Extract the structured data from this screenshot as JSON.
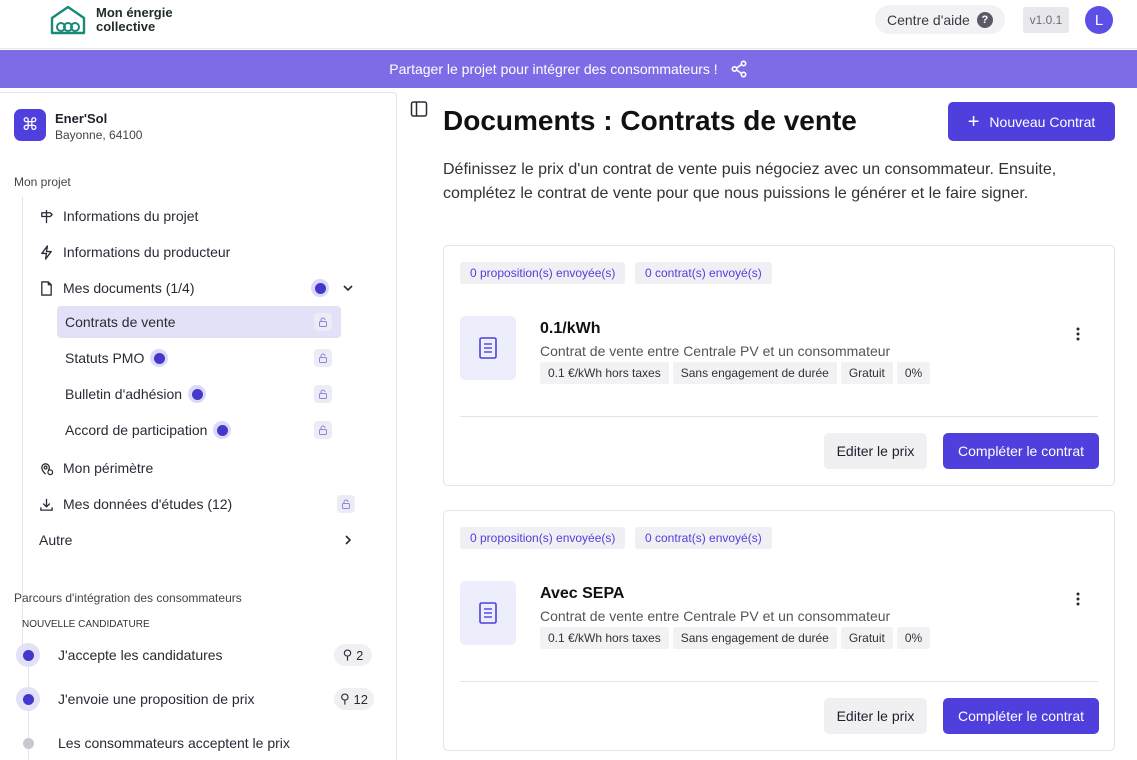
{
  "header": {
    "logo_line1": "Mon énergie",
    "logo_line2": "collective",
    "help_label": "Centre d'aide",
    "help_icon": "?",
    "version": "v1.0.1",
    "avatar_initial": "L"
  },
  "banner": {
    "text": "Partager le projet pour intégrer des consommateurs !",
    "icon": "share-icon"
  },
  "sidebar": {
    "project": {
      "icon": "⌘",
      "name": "Ener'Sol",
      "location": "Bayonne, 64100"
    },
    "section_project": "Mon projet",
    "items": {
      "info_projet": "Informations du projet",
      "info_producteur": "Informations du producteur",
      "mes_documents": "Mes documents (1/4)",
      "contrats": "Contrats de vente",
      "statuts": "Statuts PMO",
      "bulletin": "Bulletin d'adhésion",
      "accord": "Accord de participation",
      "perimetre": "Mon périmètre",
      "donnees": "Mes données d'études (12)",
      "autre": "Autre"
    },
    "section_parcours": "Parcours d'intégration des consommateurs",
    "stage_label": "NOUVELLE CANDIDATURE",
    "steps": [
      {
        "label": "J'accepte les candidatures",
        "count": "2"
      },
      {
        "label": "J'envoie une proposition de prix",
        "count": "12"
      },
      {
        "label": "Les consommateurs acceptent le prix",
        "count": ""
      }
    ]
  },
  "main": {
    "title": "Documents : Contrats de vente",
    "new_button": "Nouveau Contrat",
    "description": "Définissez le prix d'un contrat de vente puis négociez avec un consommateur. Ensuite, complétez le contrat de vente pour que nous puissions le générer et le faire signer.",
    "contracts": [
      {
        "chip_proposals": "0 proposition(s) envoyée(s)",
        "chip_contracts": "0 contrat(s) envoyé(s)",
        "title": "0.1/kWh",
        "subtitle": "Contrat de vente entre Centrale PV et un consommateur",
        "tags": [
          "0.1 €/kWh hors taxes",
          "Sans engagement de durée",
          "Gratuit",
          "0%"
        ],
        "edit_label": "Editer le prix",
        "complete_label": "Compléter le contrat"
      },
      {
        "chip_proposals": "0 proposition(s) envoyée(s)",
        "chip_contracts": "0 contrat(s) envoyé(s)",
        "title": "Avec SEPA",
        "subtitle": "Contrat de vente entre Centrale PV et un consommateur",
        "tags": [
          "0.1 €/kWh hors taxes",
          "Sans engagement de durée",
          "Gratuit",
          "0%"
        ],
        "edit_label": "Editer le prix",
        "complete_label": "Compléter le contrat"
      }
    ]
  },
  "colors": {
    "accent": "#4f3fdc",
    "banner": "#7c6ce6",
    "active_bg": "#e3e1f8"
  }
}
